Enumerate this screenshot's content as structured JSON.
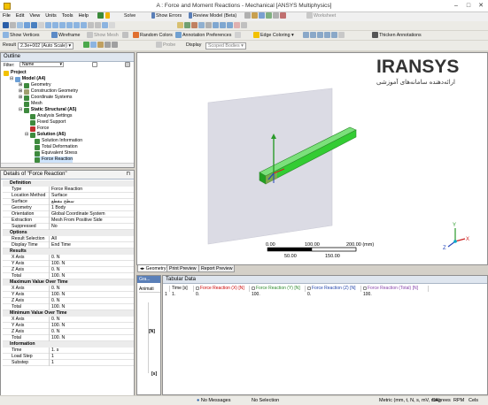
{
  "window": {
    "title": "A : Force and Moment Reactions - Mechanical [ANSYS Multiphysics]"
  },
  "menu": [
    "File",
    "Edit",
    "View",
    "Units",
    "Tools",
    "Help"
  ],
  "toolbar1": {
    "solve": "Solve",
    "show_errors": "Show Errors",
    "review": "Review Model (Beta)",
    "worksheet": "Worksheet"
  },
  "toolbar2": {
    "show_vertices": "Show Vertices",
    "wireframe": "Wireframe",
    "show_mesh": "Show Mesh",
    "random_colors": "Random Colors",
    "annotation_prefs": "Annotation Preferences",
    "edge_coloring": "Edge Coloring",
    "thicken": "Thicken Annotations"
  },
  "toolbar3": {
    "result_label": "Result",
    "scale": "2.3e+002 (Auto Scale)",
    "probe": "Probe",
    "display": "Display",
    "scoped_bodies": "Scoped Bodies"
  },
  "outline": {
    "title": "Outline",
    "filter_label": "Filter:",
    "filter_value": "Name",
    "nodes": [
      {
        "label": "Project",
        "bold": true
      },
      {
        "label": "Model (A4)",
        "bold": true
      },
      {
        "label": "Geometry",
        "bold": false
      },
      {
        "label": "Construction Geometry",
        "bold": false
      },
      {
        "label": "Coordinate Systems",
        "bold": false
      },
      {
        "label": "Mesh",
        "bold": false
      },
      {
        "label": "Static Structural (A5)",
        "bold": true
      },
      {
        "label": "Analysis Settings",
        "bold": false
      },
      {
        "label": "Fixed Support",
        "bold": false
      },
      {
        "label": "Force",
        "bold": false
      },
      {
        "label": "Solution (A6)",
        "bold": true
      },
      {
        "label": "Solution Information",
        "bold": false
      },
      {
        "label": "Total Deformation",
        "bold": false
      },
      {
        "label": "Equivalent Stress",
        "bold": false
      },
      {
        "label": "Force Reaction",
        "bold": false
      }
    ]
  },
  "details": {
    "title": "Details of \"Force Reaction\"",
    "sections": [
      {
        "name": "Definition",
        "rows": [
          [
            "Type",
            "Force Reaction"
          ],
          [
            "Location Method",
            "Surface"
          ],
          [
            "Surface",
            "سطح مقطع"
          ],
          [
            "Geometry",
            "1 Body"
          ],
          [
            "Orientation",
            "Global Coordinate System"
          ],
          [
            "Extraction",
            "Mesh From Positive Side"
          ],
          [
            "Suppressed",
            "No"
          ]
        ]
      },
      {
        "name": "Options",
        "rows": [
          [
            "Result Selection",
            "All"
          ],
          [
            "Display Time",
            "End Time"
          ]
        ]
      },
      {
        "name": "Results",
        "rows": [
          [
            "X Axis",
            "0. N"
          ],
          [
            "Y Axis",
            "100. N"
          ],
          [
            "Z Axis",
            "0. N"
          ],
          [
            "Total",
            "100. N"
          ]
        ]
      },
      {
        "name": "Maximum Value Over Time",
        "rows": [
          [
            "X Axis",
            "0. N"
          ],
          [
            "Y Axis",
            "100. N"
          ],
          [
            "Z Axis",
            "0. N"
          ],
          [
            "Total",
            "100. N"
          ]
        ]
      },
      {
        "name": "Minimum Value Over Time",
        "rows": [
          [
            "X Axis",
            "0. N"
          ],
          [
            "Y Axis",
            "100. N"
          ],
          [
            "Z Axis",
            "0. N"
          ],
          [
            "Total",
            "100. N"
          ]
        ]
      },
      {
        "name": "Information",
        "rows": [
          [
            "Time",
            "1. s"
          ],
          [
            "Load Step",
            "1"
          ],
          [
            "Substep",
            "1"
          ]
        ]
      }
    ]
  },
  "viewport": {
    "logo_text": "IRANSYS",
    "logo_sub": "ارائه‌دهنده سامانه‌های آموزشی",
    "scale_bar": {
      "top": [
        "0.00",
        "100.00",
        "200.00 (mm)"
      ],
      "bottom": [
        "50.00",
        "150.00"
      ]
    },
    "triad": {
      "x": "X",
      "y": "Y",
      "z": "Z"
    },
    "tabs": [
      "Geometry",
      "Print Preview",
      "Report Preview"
    ],
    "accent": "#33cc33"
  },
  "graph": {
    "title": "Gra...",
    "animation": "Animati",
    "unit_n": "[N]",
    "unit_s": "[s]"
  },
  "tabular": {
    "title": "Tabular Data",
    "columns": [
      "Time [s]",
      "Force Reaction (X) [N]",
      "Force Reaction (Y) [N]",
      "Force Reaction (Z) [N]",
      "Force Reaction (Total) [N]"
    ],
    "column_colors": [
      "#000000",
      "#cc0000",
      "#2d8a2d",
      "#2244aa",
      "#8844aa"
    ],
    "rows": [
      [
        "1",
        "1.",
        "0.",
        "100.",
        "0.",
        "100."
      ]
    ]
  },
  "status": {
    "messages": "No Messages",
    "selection": "No Selection",
    "units": "Metric (mm, t, N, s, mV, mA)",
    "angle": "Degrees",
    "rpm": "RPM",
    "temp": "Cels"
  }
}
